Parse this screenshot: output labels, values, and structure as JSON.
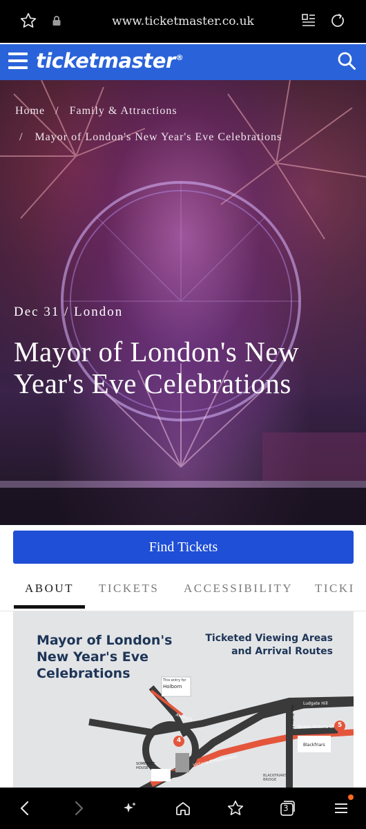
{
  "browser": {
    "url": "www.ticketmaster.co.uk",
    "tab_count": "3"
  },
  "header": {
    "logo_text": "ticketmaster",
    "logo_reg": "®",
    "brand_color": "#2a63d9"
  },
  "breadcrumb": {
    "home": "Home",
    "sep1": "/",
    "category": "Family & Attractions",
    "sep2": "/",
    "current": "Mayor of London's New Year's Eve Celebrations"
  },
  "event": {
    "date_location": "Dec 31 / London",
    "title": "Mayor of London's New Year's Eve Celebrations"
  },
  "find_tickets": {
    "label": "Find Tickets",
    "color": "#1f4fd6"
  },
  "tabs": [
    {
      "label": "ABOUT",
      "active": true
    },
    {
      "label": "TICKETS",
      "active": false
    },
    {
      "label": "ACCESSIBILITY",
      "active": false
    },
    {
      "label": "TICKI",
      "active": false
    }
  ],
  "map": {
    "title": "Mayor of London's New Year's Eve Celebrations",
    "subtitle": "Ticketed Viewing Areas and Arrival Routes",
    "labels": {
      "holborn_note": "This entry for",
      "holborn": "Holborn",
      "aldwych": "Aldwych",
      "ludgate_hill": "Ludgate Hill",
      "queen_victoria": "Queen Victoria St",
      "new_bridge": "New Bridge St",
      "blackfriars": "Blackfriars",
      "somerset_house": "SOMERSET HOUSE",
      "victoria_embankment": "Victoria Embankment",
      "blackfriars_bridge": "BLACKFRIARS BRIDGE",
      "marker_4": "4",
      "marker_5": "5"
    }
  }
}
